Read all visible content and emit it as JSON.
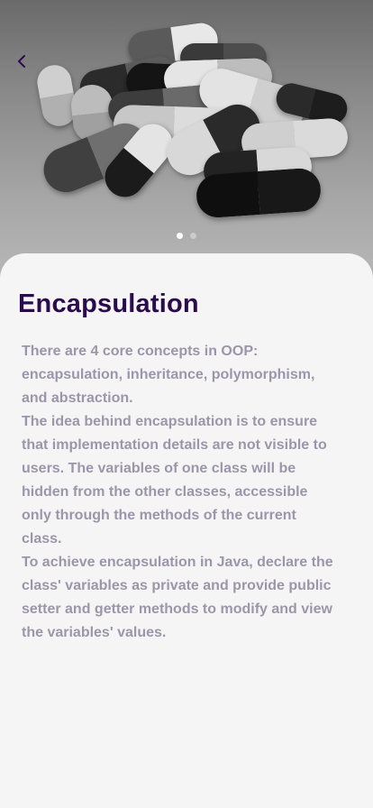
{
  "hero": {
    "image_description": "capsules",
    "back_icon": "chevron-left-icon",
    "carousel": {
      "count": 2,
      "active_index": 0
    }
  },
  "content": {
    "title": "Encapsulation",
    "paragraphs": [
      "There are 4 core concepts in OOP: encapsulation, inheritance, polymorphism, and abstraction.",
      "The idea behind encapsulation is to ensure that implementation details are not visible to users. The variables of one class will be hidden from the other classes, accessible only through the methods of the current class.",
      "To achieve encapsulation in Java, declare the class' variables as private and provide public setter and getter methods to modify and view the variables' values."
    ]
  },
  "colors": {
    "title": "#2a0c4e",
    "body_text": "#9c96aa",
    "background": "#f5f5f5",
    "back_icon": "#2a0c4e"
  }
}
